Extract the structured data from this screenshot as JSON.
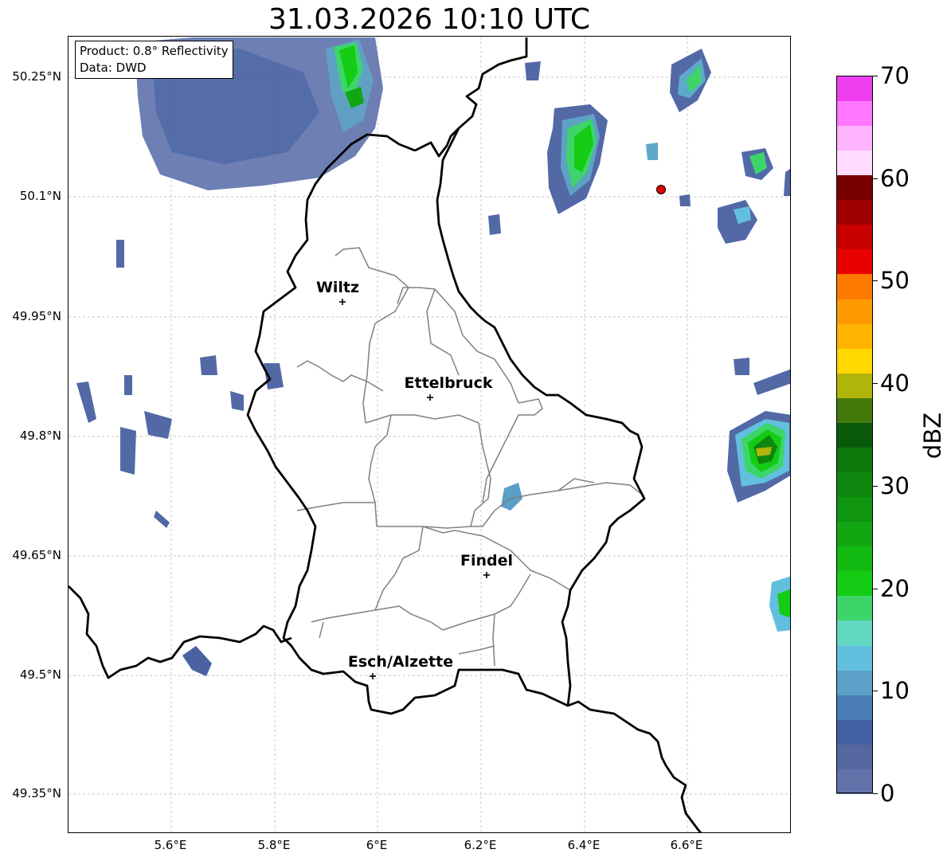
{
  "title": "31.03.2026 10:10 UTC",
  "info_box": {
    "product": "Product: 0.8° Reflectivity",
    "data": "Data: DWD"
  },
  "lat_ticks": [
    "50.25°N",
    "50.1°N",
    "49.95°N",
    "49.8°N",
    "49.65°N",
    "49.5°N",
    "49.35°N"
  ],
  "lon_ticks": [
    "5.6°E",
    "5.8°E",
    "6°E",
    "6.2°E",
    "6.4°E",
    "6.6°E"
  ],
  "cities": [
    {
      "name": "Wiltz"
    },
    {
      "name": "Ettelbruck"
    },
    {
      "name": "Findel"
    },
    {
      "name": "Esch/Alzette"
    }
  ],
  "colorbar": {
    "unit": "dBZ",
    "tick_labels": [
      "0",
      "10",
      "20",
      "30",
      "40",
      "50",
      "60",
      "70"
    ],
    "colors": [
      "#6272a9",
      "#54679e",
      "#4460a4",
      "#4a7db7",
      "#5aa0c8",
      "#62c0de",
      "#62d8c2",
      "#3dd56a",
      "#14cc14",
      "#12ba12",
      "#12a612",
      "#109510",
      "#0d870d",
      "#0c780c",
      "#0a5a0a",
      "#447a0c",
      "#b0b50a",
      "#ffd800",
      "#ffb400",
      "#ff9a00",
      "#ff7a00",
      "#e80000",
      "#c80000",
      "#a00000",
      "#780000",
      "#ffdcff",
      "#ffb4ff",
      "#ff78ff",
      "#ee3ef0"
    ]
  },
  "marker": {
    "color": "#e20000"
  }
}
